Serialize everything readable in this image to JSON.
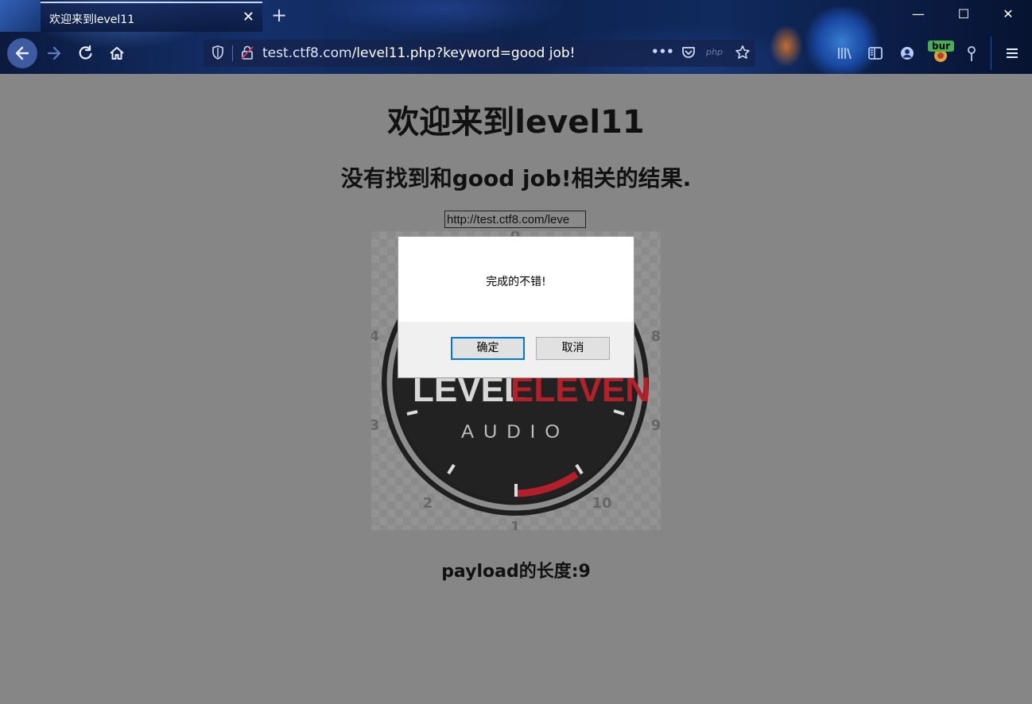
{
  "browser": {
    "tab_title": "欢迎来到level11",
    "tab_close": "✕",
    "new_tab": "+",
    "window_controls": {
      "minimize": "—",
      "maximize": "☐",
      "close": "✕"
    },
    "url": {
      "host": "test.ctf8.com",
      "path": "/level11.php?keyword=good job!"
    },
    "url_php_badge": "php",
    "url_more": "•••",
    "extension_badge": "bur",
    "icons": [
      "back-icon",
      "forward-icon",
      "reload-icon",
      "home-icon",
      "shield-icon",
      "insecure-lock-icon",
      "page-actions-icon",
      "pocket-icon",
      "star-icon",
      "library-icon",
      "sidebar-icon",
      "account-icon",
      "extension-icon",
      "pin-icon",
      "menu-icon"
    ]
  },
  "page": {
    "heading": "欢迎来到level11",
    "result_text": "没有找到和good job!相关的结果.",
    "input_value": "http://test.ctf8.com/leve",
    "payload_length_text": "payload的长度:9"
  },
  "logo": {
    "brand_primary": "LEVEL",
    "brand_secondary": "ELEVEN",
    "brand_sub": "AUDIO",
    "dial_numbers": [
      "0",
      "8",
      "9",
      "10",
      "1",
      "2",
      "3",
      "4"
    ]
  },
  "dialog": {
    "message": "完成的不错!",
    "ok_label": "确定",
    "cancel_label": "取消"
  },
  "colors": {
    "page_bg": "#868686",
    "accent": "#0078d7",
    "logo_red": "#b3202a"
  }
}
